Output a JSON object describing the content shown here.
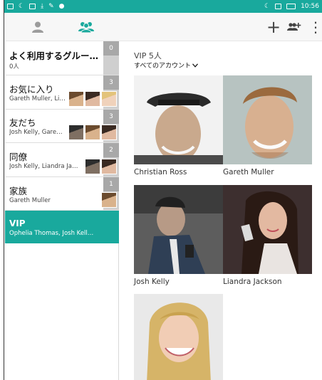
{
  "colors": {
    "accent": "#19a99d",
    "count_badge": "#a8a8a8"
  },
  "status_bar": {
    "left_icons": [
      "message-icon",
      "moon-icon",
      "image-icon",
      "download-icon",
      "tool-icon",
      "android-icon"
    ],
    "right_icons": [
      "moon-icon",
      "battery-saver-icon",
      "battery-icon"
    ],
    "time": "10:56"
  },
  "toolbar": {
    "tabs": [
      {
        "icon": "person-icon",
        "selected": false
      },
      {
        "icon": "group-icon",
        "selected": true
      }
    ],
    "add_label": "+",
    "add_group_icon": "add-group-icon",
    "more_label": "⋮"
  },
  "groups": [
    {
      "name": "よく利用するグルー…",
      "members": "0人",
      "count": "0",
      "thumbs": [],
      "selected": false
    },
    {
      "name": "お気に入り",
      "members": "Gareth Muller, Li…",
      "count": "3",
      "thumbs": [
        "thumb-gareth",
        "thumb-liandra",
        "thumb-ophelia"
      ],
      "selected": false
    },
    {
      "name": "友だち",
      "members": "Josh Kelly, Gare…",
      "count": "3",
      "thumbs": [
        "thumb-josh",
        "thumb-gareth",
        "thumb-liandra"
      ],
      "selected": false
    },
    {
      "name": "同僚",
      "members": "Josh Kelly, Liandra Ja…",
      "count": "2",
      "thumbs": [
        "thumb-josh",
        "thumb-liandra"
      ],
      "selected": false
    },
    {
      "name": "家族",
      "members": "Gareth Muller",
      "count": "1",
      "thumbs": [
        "thumb-gareth"
      ],
      "selected": false
    },
    {
      "name": "VIP",
      "members": "Ophelia Thomas, Josh Kell…",
      "count": "",
      "thumbs": [],
      "selected": true
    }
  ],
  "main": {
    "title": "VIP 5人",
    "account_filter": "すべてのアカウント",
    "contacts": [
      {
        "name": "Christian Ross",
        "photo": "hat-man-smiling"
      },
      {
        "name": "Gareth Muller",
        "photo": "blond-man-smiling"
      },
      {
        "name": "Josh Kelly",
        "photo": "man-with-phone"
      },
      {
        "name": "Liandra Jackson",
        "photo": "woman-with-phone"
      },
      {
        "name": "",
        "photo": "blonde-woman-smiling"
      }
    ]
  }
}
